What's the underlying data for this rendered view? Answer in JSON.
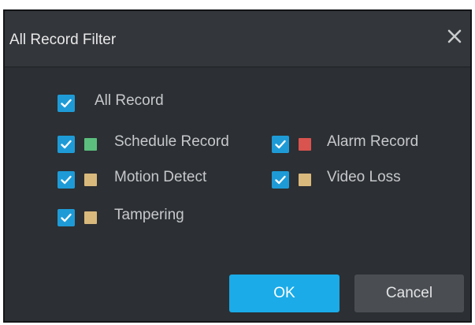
{
  "dialog": {
    "title": "All Record Filter",
    "close_icon": "close-icon"
  },
  "filters": {
    "all": {
      "label": "All Record",
      "checked": true
    },
    "items": [
      {
        "label": "Schedule Record",
        "checked": true,
        "color": "#5cbf7e"
      },
      {
        "label": "Alarm Record",
        "checked": true,
        "color": "#d9534f"
      },
      {
        "label": "Motion Detect",
        "checked": true,
        "color": "#d9b97c"
      },
      {
        "label": "Video Loss",
        "checked": true,
        "color": "#d9b97c"
      },
      {
        "label": "Tampering",
        "checked": true,
        "color": "#d9b97c"
      }
    ]
  },
  "buttons": {
    "ok": "OK",
    "cancel": "Cancel"
  },
  "colors": {
    "checkbox_accent": "#1e9bd7",
    "primary_button": "#1aabe8",
    "dialog_background": "#2c2f33"
  }
}
